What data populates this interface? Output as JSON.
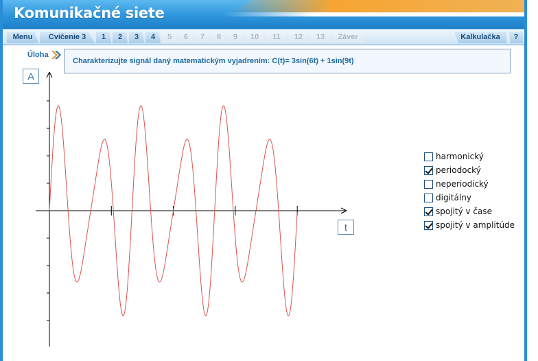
{
  "app": {
    "title": "Komunikačné siete"
  },
  "nav": {
    "items": [
      {
        "label": "Menu",
        "enabled": true
      },
      {
        "label": "Cvičenie 3",
        "enabled": true
      },
      {
        "label": "1",
        "enabled": true
      },
      {
        "label": "2",
        "enabled": true
      },
      {
        "label": "3",
        "enabled": true
      },
      {
        "label": "4",
        "enabled": true
      },
      {
        "label": "5",
        "enabled": false
      },
      {
        "label": "6",
        "enabled": false
      },
      {
        "label": "7",
        "enabled": false
      },
      {
        "label": "8",
        "enabled": false
      },
      {
        "label": "9",
        "enabled": false
      },
      {
        "label": "10",
        "enabled": false
      },
      {
        "label": "11",
        "enabled": false
      },
      {
        "label": "12",
        "enabled": false
      },
      {
        "label": "13",
        "enabled": false
      },
      {
        "label": "Záver",
        "enabled": false
      }
    ],
    "calculator": "Kalkulačka",
    "help": "?"
  },
  "task": {
    "label": "Úloha",
    "text": "Charakterizujte signál daný matematickým vyjadrením: C(t)= 3sin(6t) + 1sin(9t)"
  },
  "axes": {
    "y_label": "A",
    "x_label": "t"
  },
  "signal": {
    "amp1": 3,
    "freq1": 6,
    "amp2": 1,
    "freq2": 9,
    "t_max": 6.28
  },
  "options": [
    {
      "label": "harmonický",
      "checked": false
    },
    {
      "label": "periodocký",
      "checked": true
    },
    {
      "label": "neperiodický",
      "checked": false
    },
    {
      "label": "digitálny",
      "checked": false
    },
    {
      "label": "spojitý v čase",
      "checked": true
    },
    {
      "label": "spojitý v amplitúde",
      "checked": true
    }
  ],
  "colors": {
    "signal": "#d9534f",
    "axis": "#000000",
    "header": "#2d95dc"
  }
}
